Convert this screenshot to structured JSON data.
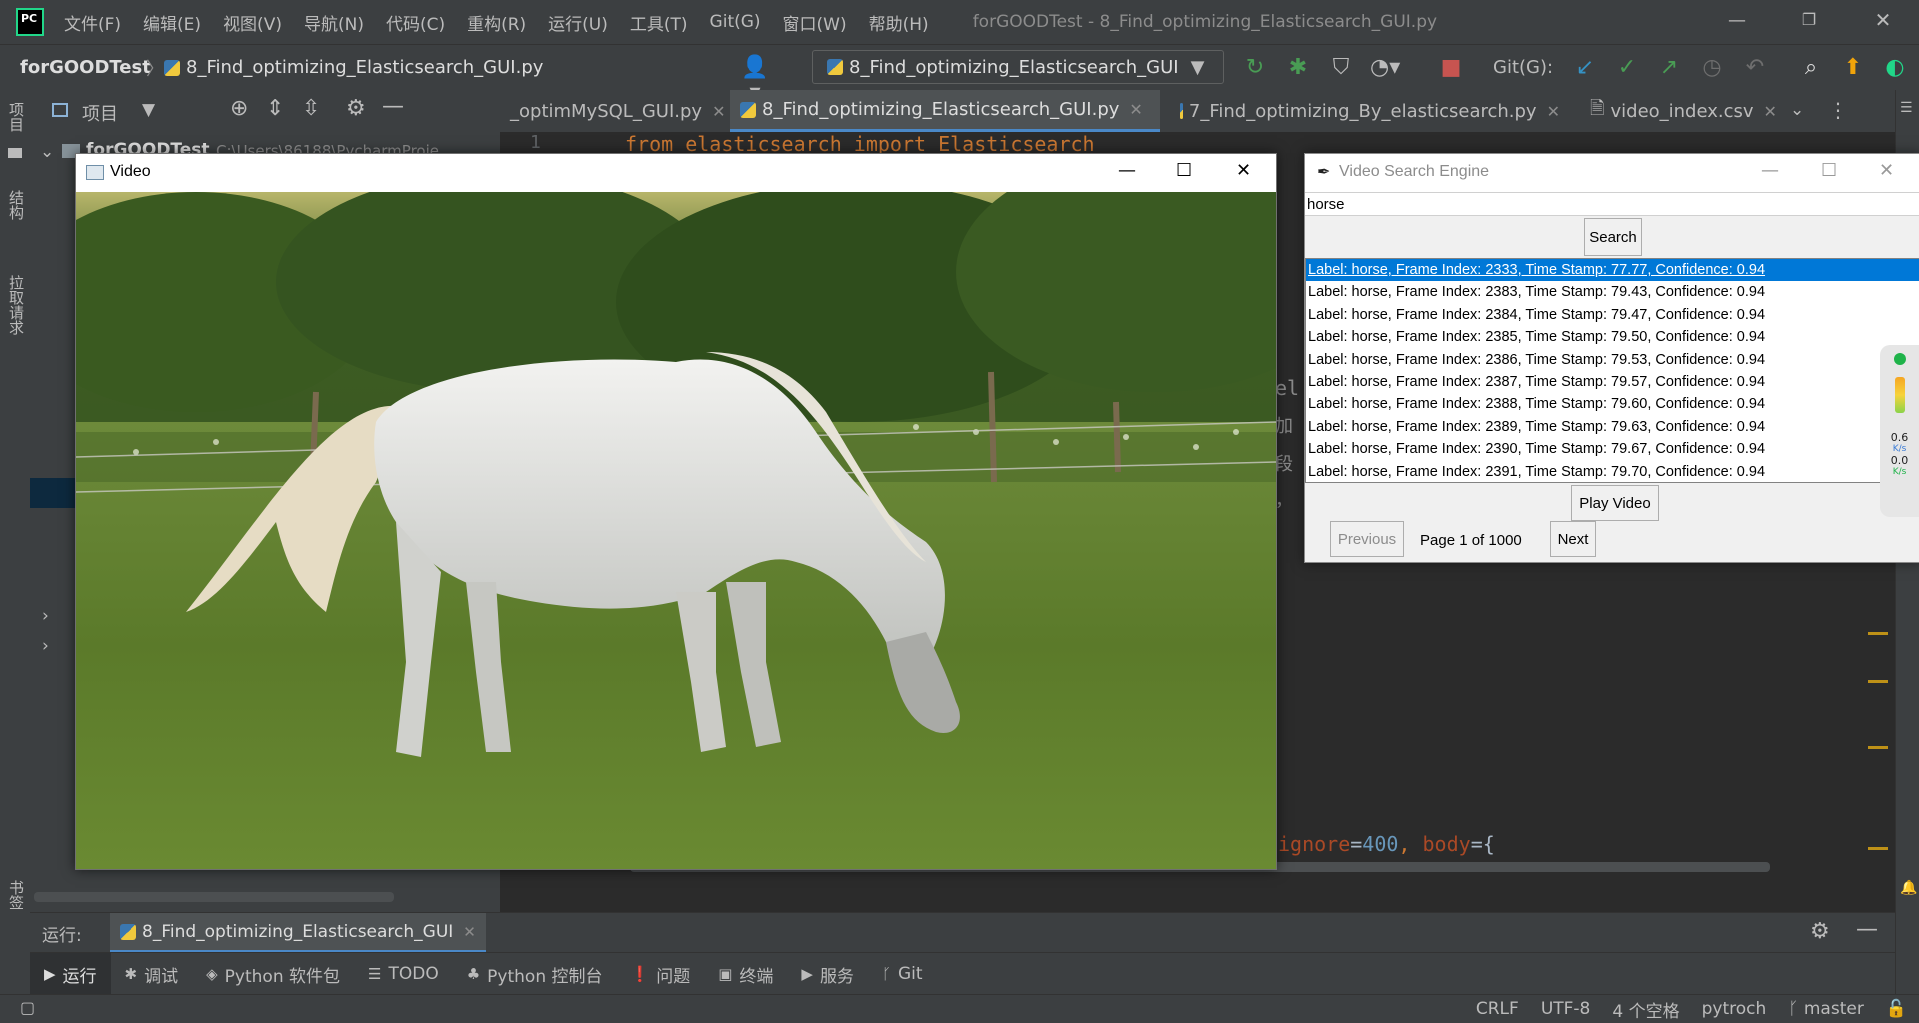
{
  "menubar": {
    "logo": "PC",
    "items": [
      "文件(F)",
      "编辑(E)",
      "视图(V)",
      "导航(N)",
      "代码(C)",
      "重构(R)",
      "运行(U)",
      "工具(T)",
      "Git(G)",
      "窗口(W)",
      "帮助(H)"
    ],
    "title": "forGOODTest - 8_Find_optimizing_Elasticsearch_GUI.py"
  },
  "navbar": {
    "project": "forGOODTest",
    "separator": "〉",
    "file": "8_Find_optimizing_Elasticsearch_GUI.py",
    "run_config": "8_Find_optimizing_Elasticsearch_GUI",
    "git_label": "Git(G):"
  },
  "left_stripe": {
    "project": "项目",
    "structure": "结构",
    "pull_requests": "拉取请求",
    "bookmarks": "书签"
  },
  "project_panel": {
    "title": "项目",
    "root_name": "forGOODTest",
    "root_path": "C:\\Users\\86188\\PycharmProje"
  },
  "tabs": [
    {
      "label": "_optimMySQL_GUI.py",
      "active": false
    },
    {
      "label": "8_Find_optimizing_Elasticsearch_GUI.py",
      "active": true
    },
    {
      "label": "7_Find_optimizing_By_elasticsearch.py",
      "active": false
    },
    {
      "label": "video_index.csv",
      "active": false
    }
  ],
  "editor": {
    "line1_number": "1",
    "line1_code": "from elasticsearch import Elasticsearch",
    "frag_el": "el",
    "frag_jia": "加",
    "frag_duan": "段",
    "frag_comma": "，",
    "bottom_code_kw": "ignore",
    "bottom_code_eq1": "=",
    "bottom_code_num": "400",
    "bottom_code_mid": ", ",
    "bottom_code_kw2": "body",
    "bottom_code_end": "={"
  },
  "video_window": {
    "title": "Video"
  },
  "search_window": {
    "title": "Video Search Engine",
    "query": "horse",
    "search_label": "Search",
    "play_label": "Play Video",
    "previous_label": "Previous",
    "next_label": "Next",
    "page_label": "Page 1 of 1000",
    "results": [
      "Label: horse, Frame Index: 2333, Time Stamp: 77.77, Confidence: 0.94",
      "Label: horse, Frame Index: 2383, Time Stamp: 79.43, Confidence: 0.94",
      "Label: horse, Frame Index: 2384, Time Stamp: 79.47, Confidence: 0.94",
      "Label: horse, Frame Index: 2385, Time Stamp: 79.50, Confidence: 0.94",
      "Label: horse, Frame Index: 2386, Time Stamp: 79.53, Confidence: 0.94",
      "Label: horse, Frame Index: 2387, Time Stamp: 79.57, Confidence: 0.94",
      "Label: horse, Frame Index: 2388, Time Stamp: 79.60, Confidence: 0.94",
      "Label: horse, Frame Index: 2389, Time Stamp: 79.63, Confidence: 0.94",
      "Label: horse, Frame Index: 2390, Time Stamp: 79.67, Confidence: 0.94",
      "Label: horse, Frame Index: 2391, Time Stamp: 79.70, Confidence: 0.94"
    ],
    "selected_index": 0
  },
  "netspeed": {
    "up_value": "0.6",
    "up_unit": "K/s",
    "down_value": "0.0",
    "down_unit": "K/s"
  },
  "run_bar": {
    "label": "运行:",
    "config": "8_Find_optimizing_Elasticsearch_GUI"
  },
  "bottom_tools": [
    {
      "icon": "play-icon",
      "label": "运行",
      "active": true
    },
    {
      "icon": "bug-icon",
      "label": "调试",
      "active": false
    },
    {
      "icon": "layers-icon",
      "label": "Python 软件包",
      "active": false
    },
    {
      "icon": "list-icon",
      "label": "TODO",
      "active": false
    },
    {
      "icon": "python-console-icon",
      "label": "Python 控制台",
      "active": false
    },
    {
      "icon": "warning-icon",
      "label": "问题",
      "active": false
    },
    {
      "icon": "terminal-icon",
      "label": "终端",
      "active": false
    },
    {
      "icon": "services-icon",
      "label": "服务",
      "active": false
    },
    {
      "icon": "git-branch-icon",
      "label": "Git",
      "active": false
    }
  ],
  "statusbar": {
    "line_sep": "CRLF",
    "encoding": "UTF-8",
    "indent": "4 个空格",
    "interpreter": "pytroch",
    "branch": "master"
  },
  "colors": {
    "ide_bg": "#2b2b2b",
    "ide_panel": "#3c3f41",
    "selection": "#0078d7",
    "accent_green": "#21d789"
  }
}
